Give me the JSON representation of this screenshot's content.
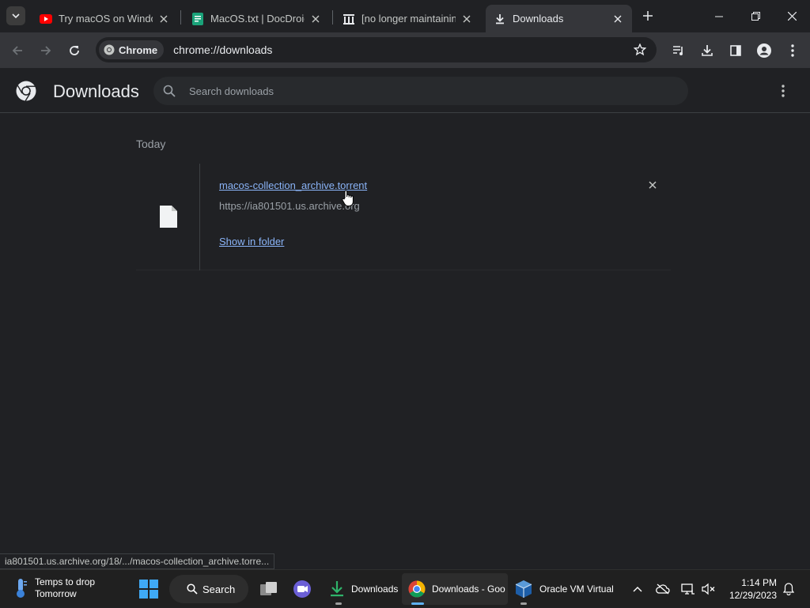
{
  "browser": {
    "tabs": [
      {
        "title": "Try macOS on Windows",
        "favicon": "youtube-icon",
        "active": false
      },
      {
        "title": "MacOS.txt | DocDroid",
        "favicon": "docdroid-icon",
        "active": false
      },
      {
        "title": "[no longer maintaining]",
        "favicon": "archive-icon",
        "active": false
      },
      {
        "title": "Downloads",
        "favicon": "download-icon",
        "active": true
      }
    ],
    "omnibox": {
      "chip_label": "Chrome",
      "url": "chrome://downloads"
    }
  },
  "downloads_page": {
    "title": "Downloads",
    "search_placeholder": "Search downloads",
    "section_date": "Today",
    "items": [
      {
        "file_name": "macos-collection_archive.torrent",
        "source_url": "https://ia801501.us.archive.org",
        "action_label": "Show in folder"
      }
    ]
  },
  "status_bar": {
    "text": "ia801501.us.archive.org/18/.../macos-collection_archive.torre..."
  },
  "taskbar": {
    "weather": {
      "line1": "Temps to drop",
      "line2": "Tomorrow"
    },
    "search_label": "Search",
    "apps": [
      {
        "label": "Downloads",
        "icon": "download-arrow-icon"
      },
      {
        "label": "Downloads - Goo",
        "icon": "chrome-icon"
      },
      {
        "label": "Oracle VM Virtual",
        "icon": "virtualbox-icon"
      }
    ],
    "clock": {
      "time": "1:14 PM",
      "date": "12/29/2023"
    }
  },
  "colors": {
    "accent": "#8ab4f8",
    "background": "#202124",
    "toolbar": "#35363a"
  }
}
